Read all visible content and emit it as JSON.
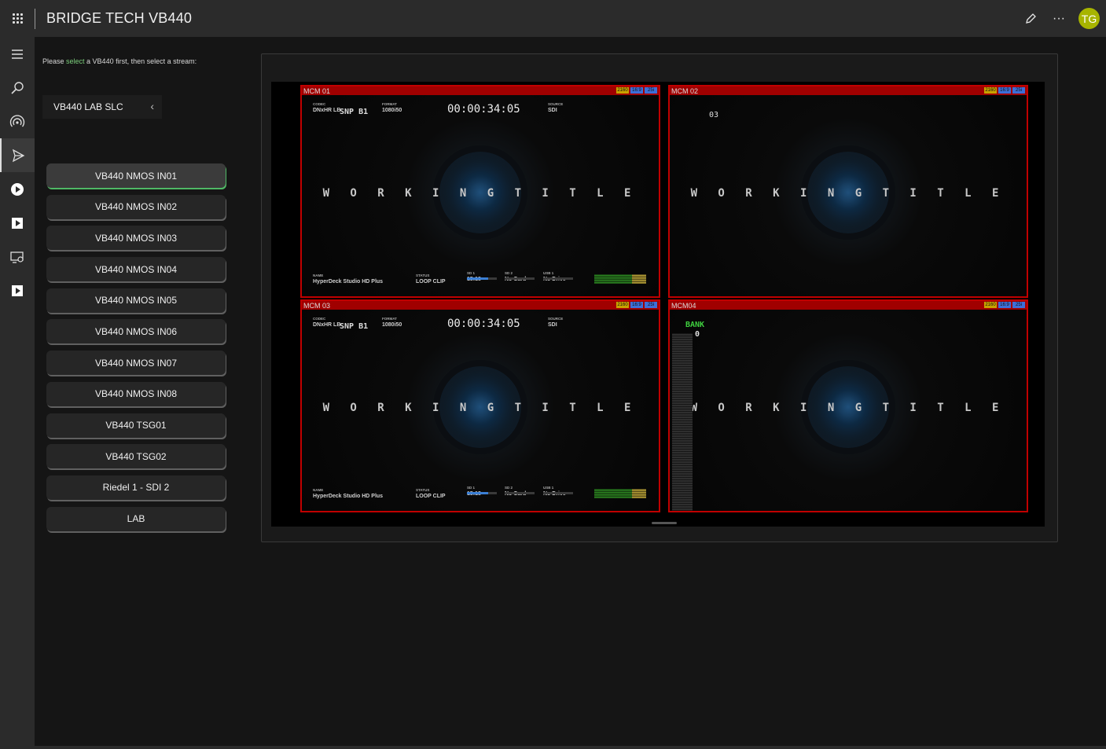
{
  "app": {
    "title": "BRIDGE TECH VB440"
  },
  "topbar": {
    "avatar_initials": "TG",
    "edit_icon": "pencil-icon",
    "more_icon": "ellipsis-icon",
    "more_label": "···"
  },
  "rail": {
    "items": [
      {
        "name": "menu-icon"
      },
      {
        "name": "search-icon"
      },
      {
        "name": "broadcast-icon"
      },
      {
        "name": "send-icon"
      },
      {
        "name": "play-circle-icon"
      },
      {
        "name": "play-square-icon"
      },
      {
        "name": "cast-icon"
      },
      {
        "name": "play-square-icon"
      }
    ]
  },
  "panel": {
    "hint_pre": "Please ",
    "hint_link": "select",
    "hint_post": " a VB440 first, then select a stream:",
    "device": {
      "label": "VB440 LAB SLC",
      "chevron": "‹"
    },
    "streams": [
      "VB440 NMOS IN01",
      "VB440 NMOS IN02",
      "VB440 NMOS IN03",
      "VB440 NMOS IN04",
      "VB440 NMOS IN05",
      "VB440 NMOS IN06",
      "VB440 NMOS IN07",
      "VB440 NMOS IN08",
      "VB440 TSG01",
      "VB440 TSG02",
      "Riedel 1 - SDI 2",
      "LAB"
    ],
    "selected_stream_index": 0
  },
  "video": {
    "tiles": [
      {
        "label": "MCM 01",
        "type": "hyperdeck"
      },
      {
        "label": "MCM 02",
        "type": "plain",
        "extra": "03"
      },
      {
        "label": "MCM 03",
        "type": "hyperdeck"
      },
      {
        "label": "MCM04",
        "type": "bank",
        "bank_label": "BANK",
        "bank_value": "0"
      }
    ],
    "slate_text": "W O R K I N G   T I T L E",
    "hyperdeck": {
      "codec_label": "CODEC",
      "codec": "DNxHR LB",
      "snp": "SNP B1",
      "format_label": "FORMAT",
      "format": "1080i50",
      "timecode": "00:00:34:05",
      "source_label": "SOURCE",
      "source": "SDI",
      "name_label": "NAME",
      "name": "HyperDeck Studio HD Plus",
      "status_label": "STATUS",
      "status": "LOOP CLIP",
      "sd1_label": "SD 1",
      "sd1": "15:18",
      "sd2_label": "SD 2",
      "sd2": "No Card",
      "usb_label": "USB 1",
      "usb": "No Drive"
    },
    "badges": [
      "2160",
      "16:9",
      "25i"
    ]
  },
  "colors": {
    "accent_green": "#4fb865",
    "tile_border": "#c00000",
    "avatar": "#a7b400"
  }
}
